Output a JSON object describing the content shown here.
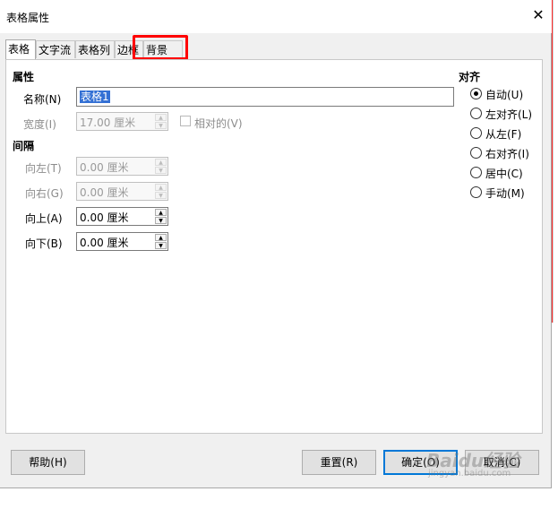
{
  "window": {
    "title": "表格属性",
    "close_glyph": "✕"
  },
  "tabs": [
    {
      "label": "表格",
      "active": true
    },
    {
      "label": "文字流",
      "active": false
    },
    {
      "label": "表格列",
      "active": false
    },
    {
      "label": "边框",
      "active": false
    },
    {
      "label": "背景",
      "active": false
    }
  ],
  "properties": {
    "heading": "属性",
    "name_label": "名称(N)",
    "name_value": "表格1",
    "width_label": "宽度(I)",
    "width_value": "17.00 厘米",
    "relative_label": "相对的(V)"
  },
  "spacing": {
    "heading": "间隔",
    "left_label": "向左(T)",
    "left_value": "0.00 厘米",
    "right_label": "向右(G)",
    "right_value": "0.00 厘米",
    "above_label": "向上(A)",
    "above_value": "0.00 厘米",
    "below_label": "向下(B)",
    "below_value": "0.00 厘米"
  },
  "alignment": {
    "heading": "对齐",
    "options": [
      {
        "label": "自动(U)",
        "checked": true
      },
      {
        "label": "左对齐(L)",
        "checked": false
      },
      {
        "label": "从左(F)",
        "checked": false
      },
      {
        "label": "右对齐(I)",
        "checked": false
      },
      {
        "label": "居中(C)",
        "checked": false
      },
      {
        "label": "手动(M)",
        "checked": false
      }
    ]
  },
  "buttons": {
    "help": "帮助(H)",
    "reset": "重置(R)",
    "ok": "确定(O)",
    "cancel": "取消(C)"
  },
  "watermark": {
    "logo": "Baidu经验",
    "url": "jingyan.baidu.com"
  },
  "colors": {
    "highlight": "#ff0000",
    "selection": "#3370d4",
    "default_button_border": "#0078d7"
  }
}
